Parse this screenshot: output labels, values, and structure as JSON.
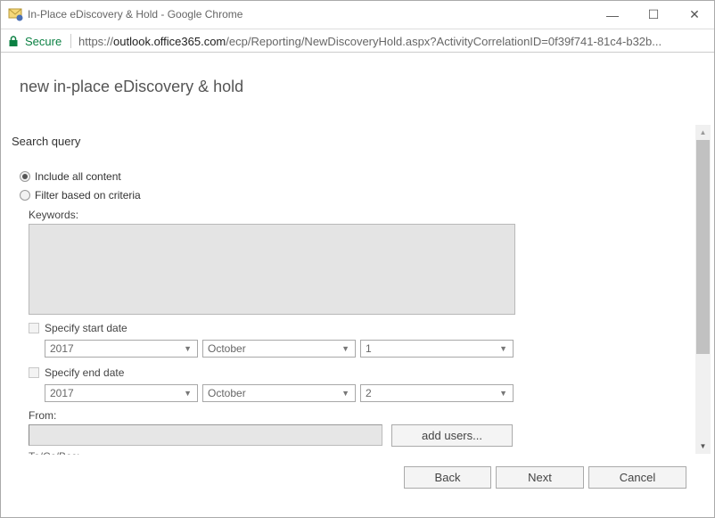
{
  "window": {
    "title": "In-Place eDiscovery & Hold - Google Chrome",
    "minimize_glyph": "—",
    "maximize_glyph": "☐",
    "close_glyph": "✕"
  },
  "addressbar": {
    "secure_label": "Secure",
    "url_scheme": "https://",
    "url_host": "outlook.office365.com",
    "url_path": "/ecp/Reporting/NewDiscoveryHold.aspx?ActivityCorrelationID=0f39f741-81c4-b32b..."
  },
  "page": {
    "title": "new in-place eDiscovery & hold",
    "section_title": "Search query"
  },
  "search_query": {
    "options": [
      {
        "label": "Include all content",
        "checked": true
      },
      {
        "label": "Filter based on criteria",
        "checked": false
      }
    ],
    "keywords_label": "Keywords:",
    "keywords_value": "",
    "start_date": {
      "label": "Specify start date",
      "checked": false,
      "year": "2017",
      "month": "October",
      "day": "1"
    },
    "end_date": {
      "label": "Specify end date",
      "checked": false,
      "year": "2017",
      "month": "October",
      "day": "2"
    },
    "from_label": "From:",
    "from_value": "",
    "add_users_label": "add users...",
    "to_cc_label": "To/Cc/Bcc:"
  },
  "footer": {
    "back_label": "Back",
    "next_label": "Next",
    "cancel_label": "Cancel"
  },
  "icons": {
    "caret": "▼",
    "scroll_up": "▲",
    "scroll_down": "▼"
  },
  "colors": {
    "secure_green": "#0b8043"
  }
}
